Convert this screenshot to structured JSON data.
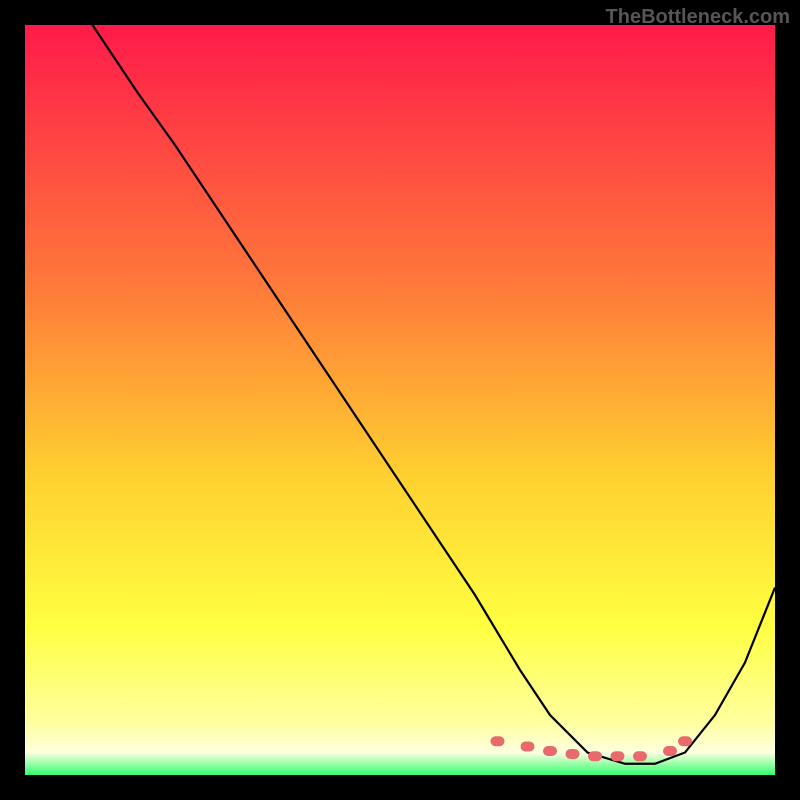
{
  "watermark": "TheBottleneck.com",
  "chart_data": {
    "type": "line",
    "title": "",
    "xlabel": "",
    "ylabel": "",
    "xlim": [
      0,
      100
    ],
    "ylim": [
      0,
      100
    ],
    "gradient_stops": [
      {
        "offset": 0,
        "color": "#ff1a4a"
      },
      {
        "offset": 0.35,
        "color": "#ff7a3a"
      },
      {
        "offset": 0.6,
        "color": "#ffd030"
      },
      {
        "offset": 0.8,
        "color": "#ffff40"
      },
      {
        "offset": 0.93,
        "color": "#ffffa0"
      },
      {
        "offset": 0.97,
        "color": "#ffffe0"
      },
      {
        "offset": 1.0,
        "color": "#30ff70"
      }
    ],
    "curve": {
      "x": [
        9,
        15,
        20,
        25,
        30,
        35,
        40,
        45,
        50,
        55,
        60,
        63,
        66,
        70,
        75,
        80,
        84,
        88,
        92,
        96,
        100
      ],
      "y": [
        100,
        91,
        84,
        76.5,
        69,
        61.5,
        54,
        46.5,
        39,
        31.5,
        24,
        19,
        14,
        8,
        3,
        1.5,
        1.5,
        3,
        8,
        15,
        25
      ]
    },
    "markers": {
      "x": [
        63,
        67,
        70,
        73,
        76,
        79,
        82,
        86,
        88
      ],
      "y": [
        4.5,
        3.8,
        3.2,
        2.8,
        2.5,
        2.5,
        2.5,
        3.2,
        4.5
      ],
      "color": "#e86a6a"
    }
  }
}
